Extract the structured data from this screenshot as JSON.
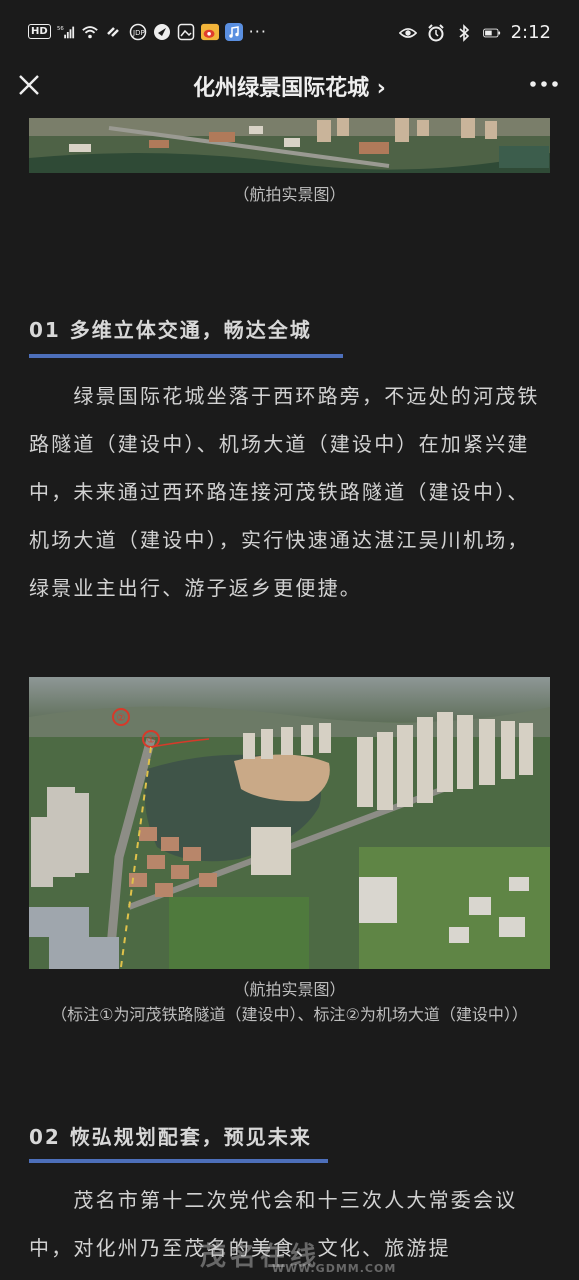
{
  "status_bar": {
    "hd": "HD",
    "network": "56",
    "time": "2:12",
    "more": "···"
  },
  "nav": {
    "title": "化州绿景国际花城 ›"
  },
  "image1": {
    "caption": "（航拍实景图）"
  },
  "section1": {
    "title": "01 多维立体交通，畅达全城",
    "paragraph": "　　绿景国际花城坐落于西环路旁，不远处的河茂铁路隧道（建设中）、机场大道（建设中）在加紧兴建中，未来通过西环路连接河茂铁路隧道（建设中）、机场大道（建设中），实行快速通达湛江吴川机场，绿景业主出行、游子返乡更便捷。"
  },
  "image2": {
    "caption_line1": "（航拍实景图）",
    "caption_line2": "（标注①为河茂铁路隧道（建设中）、标注②为机场大道（建设中））",
    "marker1": "①",
    "marker2": "②"
  },
  "section2": {
    "title": "02 恢弘规划配套，预见未来",
    "paragraph": "　　茂名市第十二次党代会和十三次人大常委会议中，对化州乃至茂名的美食、文化、旅游提"
  },
  "watermark": {
    "main": "茂名在线",
    "url": "WWW.GDMM.COM"
  },
  "colors": {
    "background": "#1b1b1b",
    "accent_bar": "#4d6fba",
    "text": "#d2d2d2"
  }
}
